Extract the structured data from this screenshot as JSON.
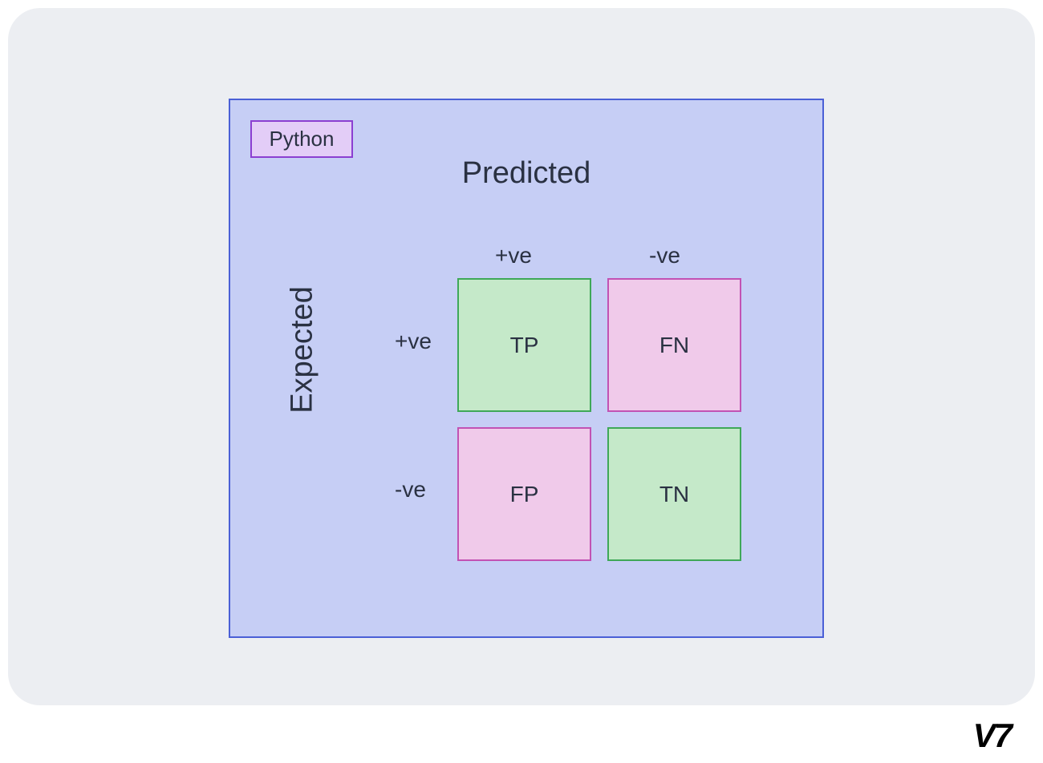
{
  "tag": "Python",
  "axis_predicted": "Predicted",
  "axis_expected": "Expected",
  "col_headers": {
    "pos": "+ve",
    "neg": "-ve"
  },
  "row_headers": {
    "pos": "+ve",
    "neg": "-ve"
  },
  "cells": {
    "tp": "TP",
    "fn": "FN",
    "fp": "FP",
    "tn": "TN"
  },
  "logo": "V7",
  "colors": {
    "panel_bg": "#c6cef5",
    "panel_border": "#4a5fd6",
    "tag_bg": "#e3cdf7",
    "tag_border": "#8b3fd1",
    "green_bg": "#c5e9c9",
    "green_border": "#3fa858",
    "pink_bg": "#f0caea",
    "pink_border": "#c252b3",
    "text": "#2a3142",
    "outer_bg": "#eceef2"
  }
}
